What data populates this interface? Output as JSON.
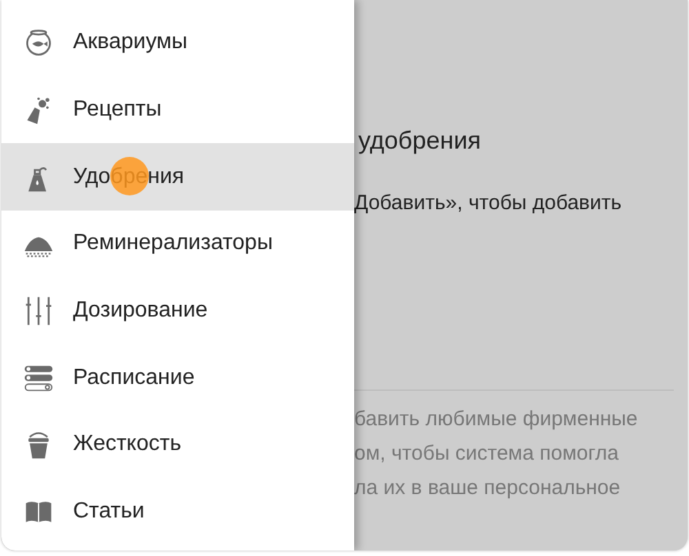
{
  "drawer": {
    "items": [
      {
        "label": "Аквариумы",
        "kind": "fishbowl",
        "selected": false
      },
      {
        "label": "Рецепты",
        "kind": "flask",
        "selected": false
      },
      {
        "label": "Удобрения",
        "kind": "bottle",
        "selected": true
      },
      {
        "label": "Реминерализаторы",
        "kind": "pile",
        "selected": false
      },
      {
        "label": "Дозирование",
        "kind": "sliders",
        "selected": false
      },
      {
        "label": "Расписание",
        "kind": "schedule",
        "selected": false
      },
      {
        "label": "Жесткость",
        "kind": "bucket",
        "selected": false
      },
      {
        "label": "Статьи",
        "kind": "book",
        "selected": false
      }
    ]
  },
  "touch_indicator": {
    "on": true
  },
  "background": {
    "title": "удобрения",
    "hint": "Добавить», чтобы добавить",
    "paragraph_lines": [
      "бавить любимые фирменные",
      "ом, чтобы система помогла",
      "ла их в ваше персональное"
    ]
  }
}
